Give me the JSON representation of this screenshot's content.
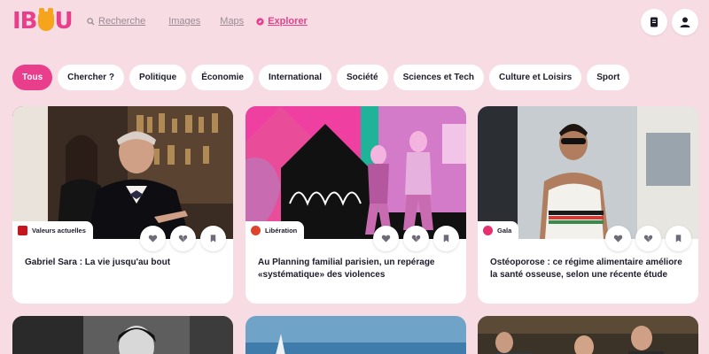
{
  "brand": {
    "name_start": "IB",
    "name_end": "U",
    "mascot": "dog-face-logo",
    "color": "#e83e8c",
    "accent": "#f7a41d"
  },
  "nav": {
    "search": "Recherche",
    "images": "Images",
    "maps": "Maps",
    "explore": "Explorer"
  },
  "header_actions": [
    {
      "icon": "bookmarks-icon"
    },
    {
      "icon": "user-icon"
    }
  ],
  "categories": [
    "Tous",
    "Chercher ?",
    "Politique",
    "Économie",
    "International",
    "Société",
    "Sciences et Tech",
    "Culture et Loisirs",
    "Sport"
  ],
  "active_category": "Tous",
  "articles": [
    {
      "source": "Valeurs actuelles",
      "source_color": "#c4161c",
      "title": "Gabriel Sara : La vie jusqu'au bout"
    },
    {
      "source": "Libération",
      "source_color": "#e0432b",
      "title": "Au Planning familial parisien, un repérage «systématique» des violences"
    },
    {
      "source": "Gala",
      "source_color": "#e6306f",
      "title": "Ostéoporose : ce régime alimentaire améliore la santé osseuse, selon une récente étude"
    }
  ],
  "colors": {
    "background": "#f7dde3",
    "accent": "#e83e8c"
  }
}
